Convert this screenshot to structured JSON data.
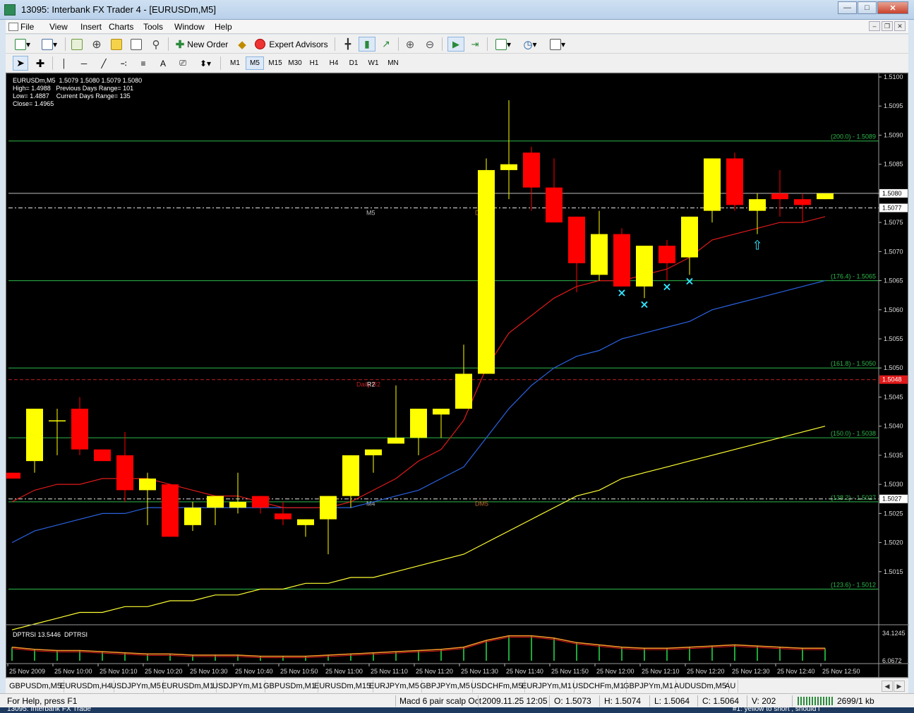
{
  "window": {
    "title": "13095: Interbank FX Trader 4 - [EURUSDm,M5]"
  },
  "menu": [
    "File",
    "View",
    "Insert",
    "Charts",
    "Tools",
    "Window",
    "Help"
  ],
  "toolbar": {
    "new_order": "New Order",
    "expert_advisors": "Expert Advisors"
  },
  "timeframes": [
    "M1",
    "M5",
    "M15",
    "M30",
    "H1",
    "H4",
    "D1",
    "W1",
    "MN"
  ],
  "active_timeframe": "M5",
  "chart_info": {
    "line1": "EURUSDm,M5  1.5079 1.5080 1.5079 1.5080",
    "line2": "High= 1.4988   Previous Days Range= 101",
    "line3": "Low= 1.4887    Current Days Range= 135",
    "line4": "Close= 1.4965"
  },
  "indicator_label": "DPTRSI 13.5446  DPTRSI",
  "indicator_scale": {
    "top": "34.1245",
    "bottom": "6.0672"
  },
  "chart_labels": {
    "m5": "M5",
    "m4": "M4",
    "dm6": "DM6",
    "dm5": "DM5",
    "r2": "R2",
    "daily_r2": "Daily R2"
  },
  "colors": {
    "bull": "#ffff00",
    "bear": "#ff0000",
    "fib": "#2db84a",
    "sma_red": "#e01a1a",
    "sma_blue": "#2a62e0",
    "sma_yellow": "#ffff33",
    "marker": "#33e5ff"
  },
  "chart_data": {
    "type": "candlestick",
    "symbol": "EURUSDm",
    "timeframe": "M5",
    "ylim": [
      1.5006,
      1.51
    ],
    "y_ticks": [
      "1.5100",
      "1.5095",
      "1.5090",
      "1.5085",
      "1.5080",
      "1.5075",
      "1.5070",
      "1.5065",
      "1.5060",
      "1.5055",
      "1.5050",
      "1.5045",
      "1.5040",
      "1.5035",
      "1.5030",
      "1.5025",
      "1.5020",
      "1.5015"
    ],
    "x_ticks": [
      "25 Nov 2009",
      "25 Nov 10:00",
      "25 Nov 10:10",
      "25 Nov 10:20",
      "25 Nov 10:30",
      "25 Nov 10:40",
      "25 Nov 10:50",
      "25 Nov 11:00",
      "25 Nov 11:10",
      "25 Nov 11:20",
      "25 Nov 11:30",
      "25 Nov 11:40",
      "25 Nov 11:50",
      "25 Nov 12:00",
      "25 Nov 12:10",
      "25 Nov 12:20",
      "25 Nov 12:30",
      "25 Nov 12:40",
      "25 Nov 12:50"
    ],
    "candles": [
      [
        1.5032,
        1.5032,
        1.5031,
        1.5031
      ],
      [
        1.5034,
        1.5043,
        1.5032,
        1.5043
      ],
      [
        1.5041,
        1.5043,
        1.5035,
        1.5041
      ],
      [
        1.5043,
        1.5045,
        1.5035,
        1.5036
      ],
      [
        1.5036,
        1.5036,
        1.5034,
        1.5034
      ],
      [
        1.5035,
        1.5039,
        1.5027,
        1.5029
      ],
      [
        1.5029,
        1.5032,
        1.5023,
        1.5031
      ],
      [
        1.503,
        1.503,
        1.5021,
        1.5021
      ],
      [
        1.5023,
        1.5027,
        1.5022,
        1.5026
      ],
      [
        1.5026,
        1.5028,
        1.5023,
        1.5028
      ],
      [
        1.5026,
        1.5032,
        1.5025,
        1.5027
      ],
      [
        1.5028,
        1.5028,
        1.5025,
        1.5026
      ],
      [
        1.5025,
        1.5027,
        1.5023,
        1.5024
      ],
      [
        1.5023,
        1.5024,
        1.5021,
        1.5024
      ],
      [
        1.5024,
        1.5028,
        1.5018,
        1.5028
      ],
      [
        1.5028,
        1.5035,
        1.5026,
        1.5035
      ],
      [
        1.5035,
        1.5036,
        1.5032,
        1.5036
      ],
      [
        1.5037,
        1.5047,
        1.5037,
        1.5038
      ],
      [
        1.5038,
        1.5043,
        1.5035,
        1.5043
      ],
      [
        1.5042,
        1.5043,
        1.5038,
        1.5043
      ],
      [
        1.5043,
        1.5054,
        1.5043,
        1.5049
      ],
      [
        1.5049,
        1.5086,
        1.5049,
        1.5084
      ],
      [
        1.5084,
        1.5096,
        1.5079,
        1.5085
      ],
      [
        1.5087,
        1.5088,
        1.5077,
        1.5081
      ],
      [
        1.5081,
        1.5086,
        1.5076,
        1.5075
      ],
      [
        1.5076,
        1.5076,
        1.5063,
        1.5068
      ],
      [
        1.5066,
        1.5077,
        1.5065,
        1.5073
      ],
      [
        1.5073,
        1.5074,
        1.5064,
        1.5064
      ],
      [
        1.5064,
        1.5071,
        1.5062,
        1.5071
      ],
      [
        1.5071,
        1.5072,
        1.5065,
        1.5068
      ],
      [
        1.5069,
        1.5076,
        1.5066,
        1.5076
      ],
      [
        1.5077,
        1.5086,
        1.5075,
        1.5086
      ],
      [
        1.5086,
        1.5087,
        1.5077,
        1.5078
      ],
      [
        1.5077,
        1.508,
        1.5073,
        1.5079
      ],
      [
        1.508,
        1.5084,
        1.5076,
        1.5079
      ],
      [
        1.5079,
        1.508,
        1.5075,
        1.5078
      ],
      [
        1.5079,
        1.508,
        1.5079,
        1.508
      ]
    ],
    "fib_levels": [
      {
        "label": "(200.0) - 1.5089",
        "price": 1.5089
      },
      {
        "label": "(176.4) - 1.5065",
        "price": 1.5065
      },
      {
        "label": "(161.8) - 1.5050",
        "price": 1.505
      },
      {
        "label": "(150.0) - 1.5038",
        "price": 1.5038
      },
      {
        "label": "(138.2) - 1.5027",
        "price": 1.5027
      },
      {
        "label": "(123.6) - 1.5012",
        "price": 1.5012
      }
    ],
    "price_tags": [
      {
        "label": "1.5080",
        "price": 1.508
      },
      {
        "label": "1.5077",
        "price": 1.50775
      },
      {
        "label": "1.5048",
        "price": 1.5048
      },
      {
        "label": "1.5027",
        "price": 1.50275
      }
    ],
    "sma_red": [
      1.5027,
      1.5029,
      1.503,
      1.503,
      1.5031,
      1.5031,
      1.5031,
      1.503,
      1.5029,
      1.5028,
      1.5028,
      1.5027,
      1.5026,
      1.5026,
      1.5026,
      1.5027,
      1.5029,
      1.5031,
      1.5034,
      1.5036,
      1.5041,
      1.505,
      1.5056,
      1.5059,
      1.5062,
      1.5064,
      1.5065,
      1.5065,
      1.5066,
      1.5067,
      1.5069,
      1.5072,
      1.5073,
      1.5074,
      1.5075,
      1.5075,
      1.5076
    ],
    "sma_blue": [
      1.502,
      1.5022,
      1.5023,
      1.5024,
      1.5025,
      1.5025,
      1.5026,
      1.5026,
      1.5026,
      1.5026,
      1.5026,
      1.5026,
      1.5026,
      1.5026,
      1.5026,
      1.5026,
      1.5027,
      1.5028,
      1.5029,
      1.5031,
      1.5033,
      1.5038,
      1.5043,
      1.5047,
      1.505,
      1.5052,
      1.5053,
      1.5055,
      1.5056,
      1.5057,
      1.5058,
      1.506,
      1.5061,
      1.5062,
      1.5063,
      1.5064,
      1.5065
    ],
    "sma_yellow": [
      1.5005,
      1.5006,
      1.5007,
      1.5008,
      1.5008,
      1.5009,
      1.5009,
      1.501,
      1.501,
      1.5011,
      1.5011,
      1.5012,
      1.5012,
      1.5013,
      1.5013,
      1.5014,
      1.5014,
      1.5015,
      1.5016,
      1.5017,
      1.5018,
      1.502,
      1.5022,
      1.5024,
      1.5026,
      1.5028,
      1.5029,
      1.5031,
      1.5032,
      1.5033,
      1.5034,
      1.5035,
      1.5036,
      1.5037,
      1.5038,
      1.5039,
      1.504
    ],
    "cross_markers": [
      27,
      28,
      29,
      30
    ],
    "arrow_marker": 33,
    "dptrsi": [
      18,
      16,
      15,
      15,
      14,
      13,
      12,
      12,
      11,
      11,
      11,
      10,
      10,
      10,
      11,
      12,
      13,
      14,
      15,
      16,
      18,
      24,
      28,
      28,
      26,
      22,
      20,
      18,
      17,
      17,
      18,
      19,
      20,
      19,
      18,
      17,
      17
    ]
  },
  "tabs": [
    "GBPUSDm,M5",
    "EURUSDm,H4",
    "USDJPYm,M5",
    "EURUSDm,M1",
    "USDJPYm,M1",
    "GBPUSDm,M1",
    "EURUSDm,M15",
    "EURJPYm,M5",
    "GBPJPYm,M5",
    "USDCHFm,M5",
    "EURJPYm,M1",
    "USDCHFm,M1",
    "GBPJPYm,M1",
    "AUDUSDm,M5",
    "AU"
  ],
  "active_tab": "EURUSDm,M5",
  "status": {
    "help": "For Help, press F1",
    "profile": "Macd 6 pair scalp Oct",
    "datetime": "2009.11.25 12:05",
    "open": "O: 1.5073",
    "high": "H: 1.5074",
    "low": "L: 1.5064",
    "close": "C: 1.5064",
    "volume": "V: 202",
    "traffic": "2699/1 kb"
  },
  "taskbar": {
    "left": "13095: Interbank FX Trade",
    "middle": "#1: yellow to short , should l"
  }
}
